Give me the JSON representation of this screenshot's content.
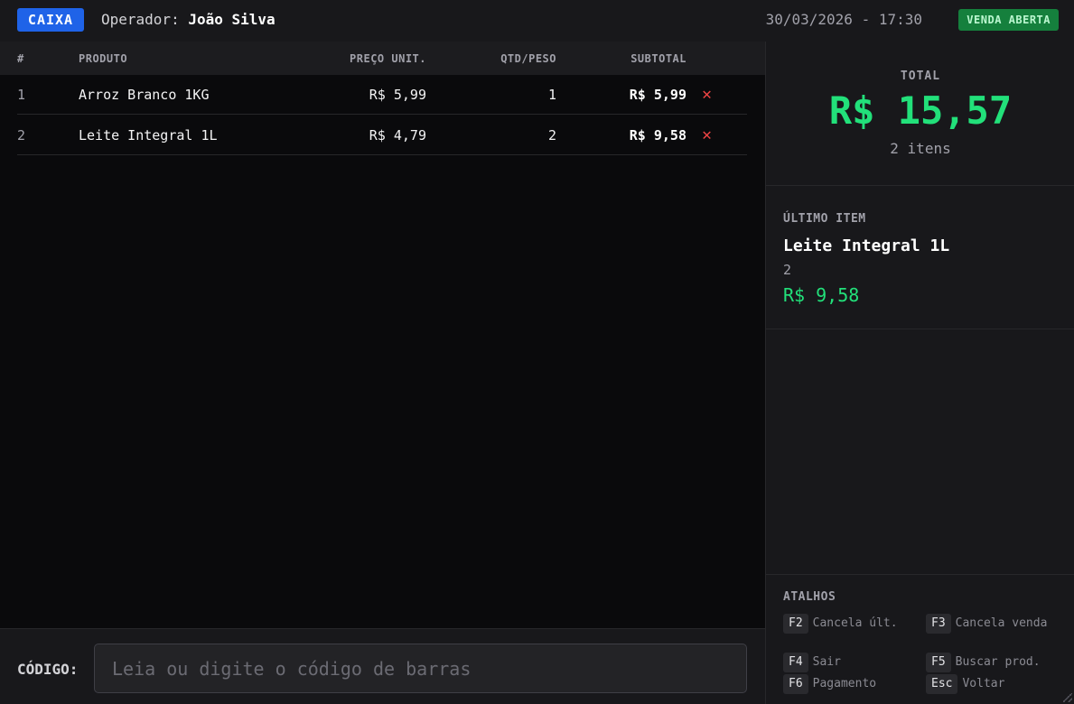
{
  "header": {
    "brand": "CAIXA",
    "operator_label": "Operador:",
    "operator_name": "João Silva",
    "datetime": "30/03/2026 - 17:30",
    "status": "VENDA ABERTA"
  },
  "table": {
    "columns": [
      "#",
      "PRODUTO",
      "PREÇO UNIT.",
      "QTD/PESO",
      "SUBTOTAL"
    ],
    "rows": [
      {
        "num": "1",
        "product": "Arroz Branco 1KG",
        "price": "R$ 5,99",
        "qty": "1",
        "subtotal": "R$ 5,99"
      },
      {
        "num": "2",
        "product": "Leite Integral 1L",
        "price": "R$ 4,79",
        "qty": "2",
        "subtotal": "R$ 9,58"
      }
    ]
  },
  "code": {
    "label": "CÓDIGO:",
    "value": "",
    "placeholder": "Leia ou digite o código de barras"
  },
  "summary": {
    "total_label": "TOTAL",
    "total_value": "R$ 15,57",
    "items_count": "2 itens"
  },
  "last_item": {
    "label": "ÚLTIMO ITEM",
    "name": "Leite Integral 1L",
    "qty": "2",
    "price": "R$ 9,58"
  },
  "shortcuts": {
    "label": "ATALHOS",
    "items": [
      {
        "key": "F2",
        "text": "Cancela últ."
      },
      {
        "key": "F3",
        "text": "Cancela venda"
      },
      {
        "key": "F4",
        "text": "Sair"
      },
      {
        "key": "F5",
        "text": "Buscar prod."
      },
      {
        "key": "F6",
        "text": "Pagamento"
      },
      {
        "key": "Esc",
        "text": "Voltar"
      }
    ]
  },
  "colors": {
    "brand": "#1f63e8",
    "status_bg": "#15803d",
    "total": "#22e07a",
    "delete": "#ef4444"
  },
  "icons": {
    "delete": "close-icon"
  }
}
